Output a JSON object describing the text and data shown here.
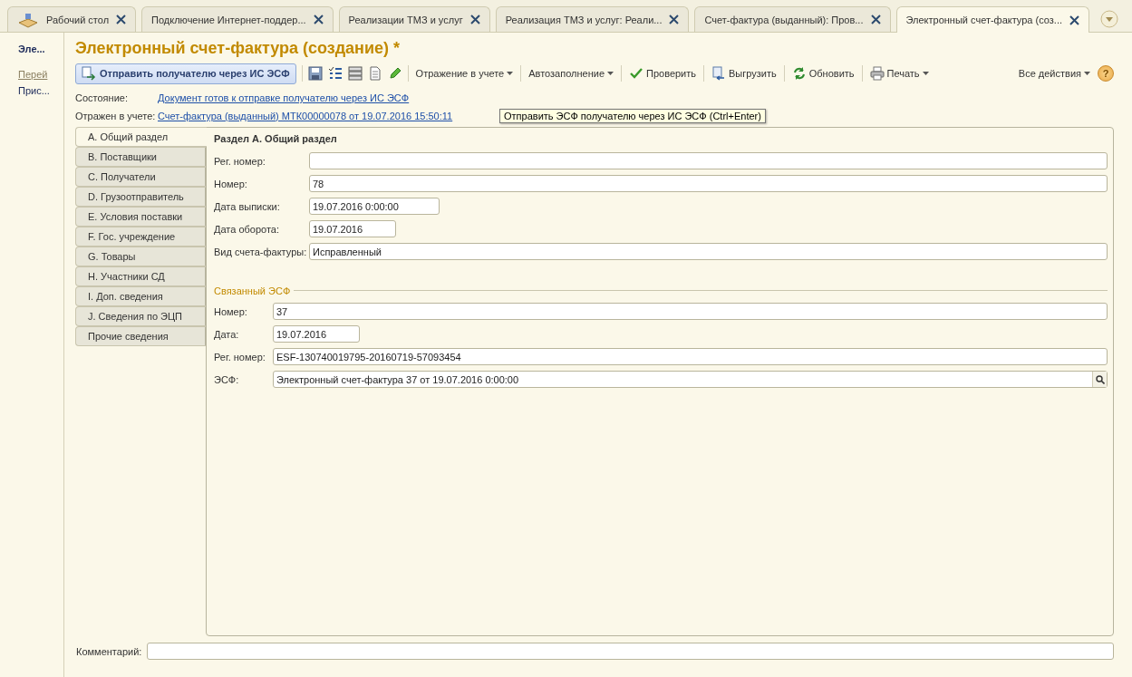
{
  "tabs": [
    {
      "label": "Рабочий стол",
      "kind": "desktop",
      "selected": false
    },
    {
      "label": "Подключение Интернет-поддер...",
      "kind": "document",
      "selected": false
    },
    {
      "label": "Реализации ТМЗ и услуг",
      "kind": "document",
      "selected": false
    },
    {
      "label": "Реализация ТМЗ и услуг: Реали...",
      "kind": "document",
      "selected": false
    },
    {
      "label": "Счет-фактура (выданный): Пров...",
      "kind": "document",
      "selected": false
    },
    {
      "label": "Электронный счет-фактура (соз...",
      "kind": "document",
      "selected": true
    }
  ],
  "nav_panel": {
    "items": [
      {
        "label": "Эле...",
        "kind": "current"
      },
      {
        "label": "Перей",
        "kind": "group"
      },
      {
        "label": "Прис...",
        "kind": "link"
      }
    ]
  },
  "form": {
    "title": "Электронный счет-фактура (создание) *",
    "send_button": "Отправить получателю через ИС ЭСФ",
    "actions": [
      {
        "label": "Отражение в учете",
        "kind": "menu"
      },
      {
        "label": "Автозаполнение",
        "kind": "menu"
      },
      {
        "label": "Проверить",
        "kind": "check"
      },
      {
        "label": "Выгрузить",
        "kind": "export"
      },
      {
        "label": "Обновить",
        "kind": "refresh"
      },
      {
        "label": "Печать",
        "kind": "print"
      }
    ],
    "all_actions": "Все действия",
    "help": "?",
    "status_label": "Состояние:",
    "status_link": "Документ готов к отправке получателю через ИС ЭСФ",
    "posted_label": "Отражен в учете:",
    "posted_link": "Счет-фактура (выданный) МТК00000078 от 19.07.2016 15:50:11",
    "tooltip": "Отправить ЭСФ получателю через ИС ЭСФ (Ctrl+Enter)",
    "section_tabs": [
      {
        "label": "A. Общий раздел",
        "selected": true
      },
      {
        "label": "B. Поставщики",
        "selected": false
      },
      {
        "label": "C. Получатели",
        "selected": false
      },
      {
        "label": "D. Грузоотправитель",
        "selected": false
      },
      {
        "label": "E. Условия поставки",
        "selected": false
      },
      {
        "label": "F. Гос. учреждение",
        "selected": false
      },
      {
        "label": "G. Товары",
        "selected": false
      },
      {
        "label": "H. Участники СД",
        "selected": false
      },
      {
        "label": "I. Доп. сведения",
        "selected": false
      },
      {
        "label": "J. Сведения по ЭЦП",
        "selected": false
      },
      {
        "label": "Прочие сведения",
        "selected": false
      }
    ],
    "section_title": "Раздел A. Общий раздел",
    "fields": [
      {
        "label": "Рег. номер:",
        "kind": "text"
      },
      {
        "label": "Номер:",
        "value": "78",
        "kind": "text"
      },
      {
        "label": "Дата выписки:",
        "value": "19.07.2016  0:00:00",
        "kind": "datetime"
      },
      {
        "label": "Дата оборота:",
        "value": "19.07.2016",
        "kind": "date"
      },
      {
        "label": "Вид счета-фактуры:",
        "value": "Исправленный",
        "kind": "text"
      }
    ],
    "linked_title": "Связанный ЭСФ",
    "linked_fields": [
      {
        "label": "Номер:",
        "value": "37",
        "kind": "text"
      },
      {
        "label": "Дата:",
        "value": "19.07.2016",
        "kind": "date"
      },
      {
        "label": "Рег. номер:",
        "value": "ESF-130740019795-20160719-57093454",
        "kind": "text"
      },
      {
        "label": "ЭСФ:",
        "value": "Электронный счет-фактура 37 от 19.07.2016 0:00:00",
        "kind": "lookup"
      }
    ],
    "comment_label": "Комментарий:"
  }
}
